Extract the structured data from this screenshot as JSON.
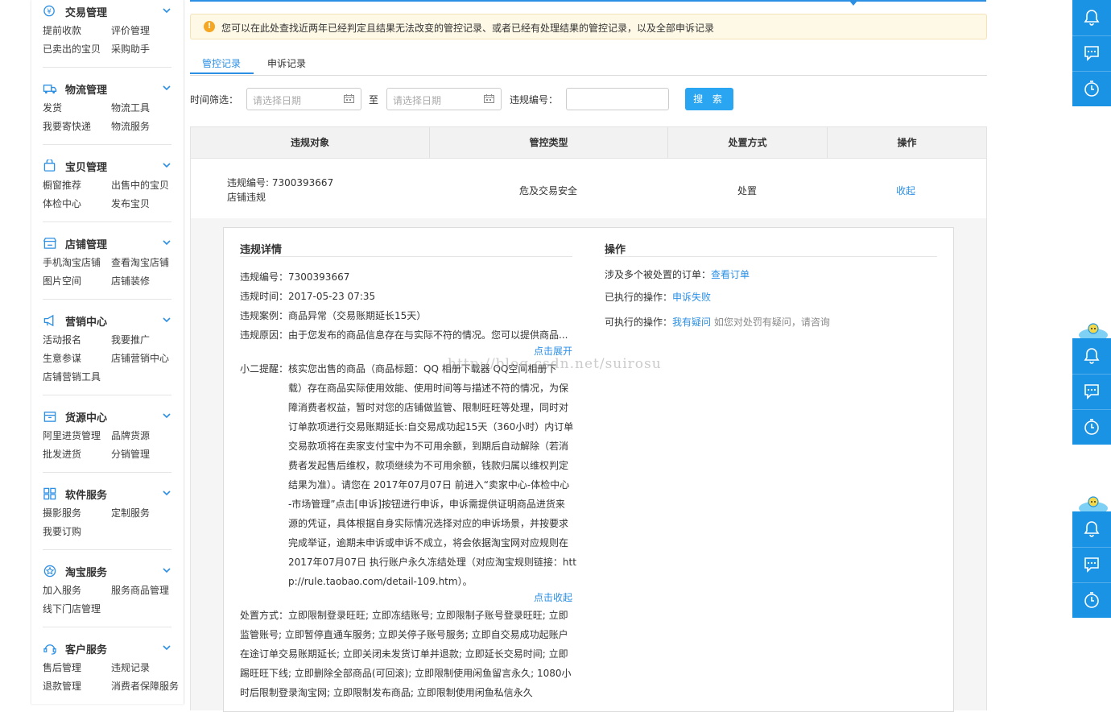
{
  "sidebar": {
    "sections": [
      {
        "title": "交易管理",
        "links": [
          "提前收款",
          "评价管理",
          "已卖出的宝贝",
          "采购助手"
        ]
      },
      {
        "title": "物流管理",
        "links": [
          "发货",
          "物流工具",
          "我要寄快递",
          "物流服务"
        ]
      },
      {
        "title": "宝贝管理",
        "links": [
          "橱窗推荐",
          "出售中的宝贝",
          "体检中心",
          "发布宝贝"
        ]
      },
      {
        "title": "店铺管理",
        "links": [
          "手机淘宝店铺",
          "查看淘宝店铺",
          "图片空间",
          "店铺装修"
        ]
      },
      {
        "title": "营销中心",
        "links": [
          "活动报名",
          "我要推广",
          "生意参谋",
          "店铺营销中心",
          "店铺营销工具"
        ]
      },
      {
        "title": "货源中心",
        "links": [
          "阿里进货管理",
          "品牌货源",
          "批发进货",
          "分销管理"
        ]
      },
      {
        "title": "软件服务",
        "links": [
          "摄影服务",
          "定制服务",
          "我要订购"
        ]
      },
      {
        "title": "淘宝服务",
        "links": [
          "加入服务",
          "服务商品管理",
          "线下门店管理"
        ]
      },
      {
        "title": "客户服务",
        "links": [
          "售后管理",
          "违规记录",
          "退款管理",
          "消费者保障服务"
        ]
      }
    ]
  },
  "notice": {
    "icon": "!",
    "text": "您可以在此处查找近两年已经判定且结果无法改变的管控记录、或者已经有处理结果的管控记录，以及全部申诉记录"
  },
  "tabs": {
    "active": "管控记录",
    "inactive": "申诉记录"
  },
  "filter": {
    "time_label": "时间筛选：",
    "date_placeholder": "请选择日期",
    "to": "至",
    "id_label": "违规编号：",
    "search": "搜 索"
  },
  "table": {
    "headers": [
      "违规对象",
      "管控类型",
      "处置方式",
      "操作"
    ],
    "row": {
      "object_line1": "违规编号: 7300393667",
      "object_line2": "店铺违规",
      "type": "危及交易安全",
      "method": "处置",
      "action": "收起"
    }
  },
  "detail": {
    "left_title": "违规详情",
    "id": "违规编号：7300393667",
    "time": "违规时间：2017-05-23 07:35",
    "case": "违规案例：商品异常（交易账期延长15天）",
    "reason": "违规原因：由于您发布的商品信息存在与实际不符的情况。您可以提供商品...",
    "expand": "点击展开",
    "tip_label": "小二提醒：",
    "tip_lines": [
      "核实您出售的商品（商品标题：QQ 相册下载器 QQ空间相册下",
      "载）存在商品实际使用效能、使用时间等与描述不符的情况，为保",
      "障消费者权益，暂时对您的店铺做监管、限制旺旺等处理，同时对",
      "订单款项进行交易账期延长:自交易成功起15天（360小时）内订单",
      "交易款项将在卖家支付宝中为不可用余额，到期后自动解除（若消",
      "费者发起售后维权，款项继续为不可用余额，钱款归属以维权判定",
      "结果为准）。请您在 2017年07月07日 前进入“卖家中心-体检中心",
      "-市场管理”点击[申诉]按钮进行申诉，申诉需提供证明商品进货来",
      "源的凭证，具体根据自身实际情况选择对应的申诉场景，并按要求",
      "完成举证，逾期未申诉或申诉不成立，将会依据淘宝网对应规则在",
      "2017年07月07日 执行账户永久冻结处理（对应淘宝规则链接：htt",
      "p://rule.taobao.com/detail-109.htm）。"
    ],
    "collapse": "点击收起",
    "method_lines": [
      "处置方式：立即限制登录旺旺; 立即冻结账号; 立即限制子账号登录旺旺; 立即",
      "监管账号; 立即暂停直通车服务; 立即关停子账号服务; 立即自交易成功起账户",
      "在途订单交易账期延长; 立即关闭未发货订单并退款; 立即延长交易时间; 立即",
      "踢旺旺下线; 立即删除全部商品(可回滚); 立即限制使用闲鱼留言永久; 1080小",
      "时后限制登录淘宝网; 立即限制发布商品; 立即限制使用闲鱼私信永久"
    ],
    "right_title": "操作",
    "orders_label": "涉及多个被处置的订单：",
    "orders_link": "查看订单",
    "done_label": "已执行的操作：",
    "done_link": "申诉失败",
    "avail_label": "可执行的操作：",
    "avail_link": "我有疑问",
    "avail_hint": "如您对处罚有疑问，请咨询"
  },
  "watermark": "http://blog.csdn.net/suirosu",
  "colors": {
    "accent": "#2b8fe4",
    "float_bar": "#1b93e5",
    "notice_bg": "#fef8e6",
    "search_btn": "#29a5f1"
  }
}
